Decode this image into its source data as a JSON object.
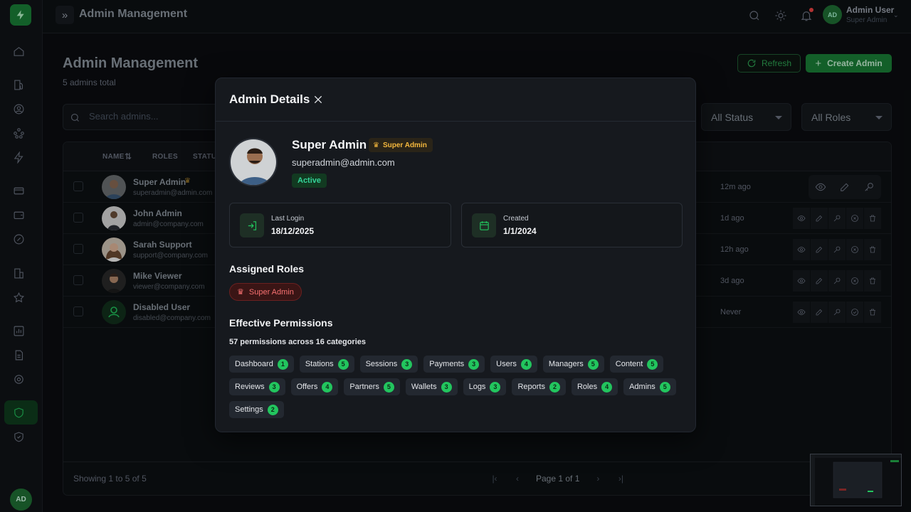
{
  "sidebar": {
    "icons": [
      "home-icon",
      "fuel-station-icon",
      "user-circle-icon",
      "network-icon",
      "lightning-icon",
      "credit-card-icon",
      "wallet-icon",
      "percent-badge-icon",
      "building-icon",
      "star-icon",
      "bar-chart-icon",
      "document-icon",
      "gear-icon",
      "shield-icon",
      "shield-check-icon"
    ],
    "avatar": "AD"
  },
  "topbar": {
    "title": "Admin Management",
    "user_initials": "AD",
    "user_name": "Admin User",
    "user_role": "Super Admin"
  },
  "page": {
    "title": "Admin Management",
    "subtitle": "5 admins total",
    "refresh_label": "Refresh",
    "create_label": "Create Admin",
    "search_placeholder": "Search admins...",
    "status_filter": "All Status",
    "roles_filter": "All Roles"
  },
  "table": {
    "headers": {
      "name": "NAME",
      "roles": "ROLES",
      "status": "STATUS"
    },
    "rows": [
      {
        "name": "Super Admin",
        "email": "superadmin@admin.com",
        "time": "12m ago"
      },
      {
        "name": "John Admin",
        "email": "admin@company.com",
        "time": "1d ago"
      },
      {
        "name": "Sarah Support",
        "email": "support@company.com",
        "time": "12h ago"
      },
      {
        "name": "Mike Viewer",
        "email": "viewer@company.com",
        "time": "3d ago"
      },
      {
        "name": "Disabled User",
        "email": "disabled@company.com",
        "time": "Never"
      }
    ],
    "footer": "Showing 1 to 5 of 5",
    "page_label": "Page 1 of 1"
  },
  "modal": {
    "title": "Admin Details",
    "name": "Super Admin",
    "role_badge": "Super Admin",
    "email": "superadmin@admin.com",
    "status": "Active",
    "last_login_label": "Last Login",
    "last_login": "18/12/2025",
    "created_label": "Created",
    "created": "1/1/2024",
    "assigned_roles_title": "Assigned Roles",
    "assigned_role": "Super Admin",
    "effective_title": "Effective Permissions",
    "permission_summary": "57 permissions across 16 categories",
    "permissions": [
      {
        "label": "Dashboard",
        "count": "1"
      },
      {
        "label": "Stations",
        "count": "5"
      },
      {
        "label": "Sessions",
        "count": "3"
      },
      {
        "label": "Payments",
        "count": "3"
      },
      {
        "label": "Users",
        "count": "4"
      },
      {
        "label": "Managers",
        "count": "5"
      },
      {
        "label": "Content",
        "count": "5"
      },
      {
        "label": "Reviews",
        "count": "3"
      },
      {
        "label": "Offers",
        "count": "4"
      },
      {
        "label": "Partners",
        "count": "5"
      },
      {
        "label": "Wallets",
        "count": "3"
      },
      {
        "label": "Logs",
        "count": "3"
      },
      {
        "label": "Reports",
        "count": "2"
      },
      {
        "label": "Roles",
        "count": "4"
      },
      {
        "label": "Admins",
        "count": "5"
      },
      {
        "label": "Settings",
        "count": "2"
      }
    ]
  },
  "colors": {
    "accent": "#22c55e",
    "brand": "#1a7f37",
    "danger": "#f87171",
    "gold": "#f5b83d"
  }
}
